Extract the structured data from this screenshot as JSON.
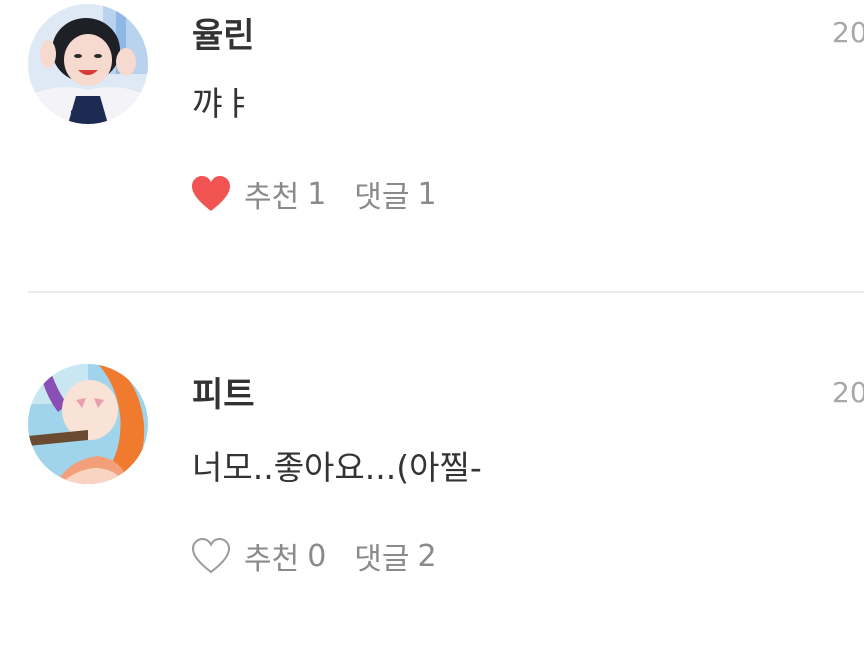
{
  "comments": [
    {
      "author": "율린",
      "date": "20",
      "text": "꺄ㅑ",
      "like_label": "추천",
      "like_count": "1",
      "reply_label": "댓글",
      "reply_count": "1",
      "liked": true
    },
    {
      "author": "피트",
      "date": "20",
      "text": "너모..좋아요...(아찔-",
      "like_label": "추천",
      "like_count": "0",
      "reply_label": "댓글",
      "reply_count": "2",
      "liked": false
    }
  ],
  "colors": {
    "heart_filled": "#f25454",
    "heart_outline": "#9a9a9a",
    "text_primary": "#333333",
    "text_secondary": "#8a8a8a",
    "date": "#a8a8a8",
    "divider": "#ebebeb"
  },
  "icons": {
    "liked": "heart-filled-icon",
    "not_liked": "heart-outline-icon"
  }
}
